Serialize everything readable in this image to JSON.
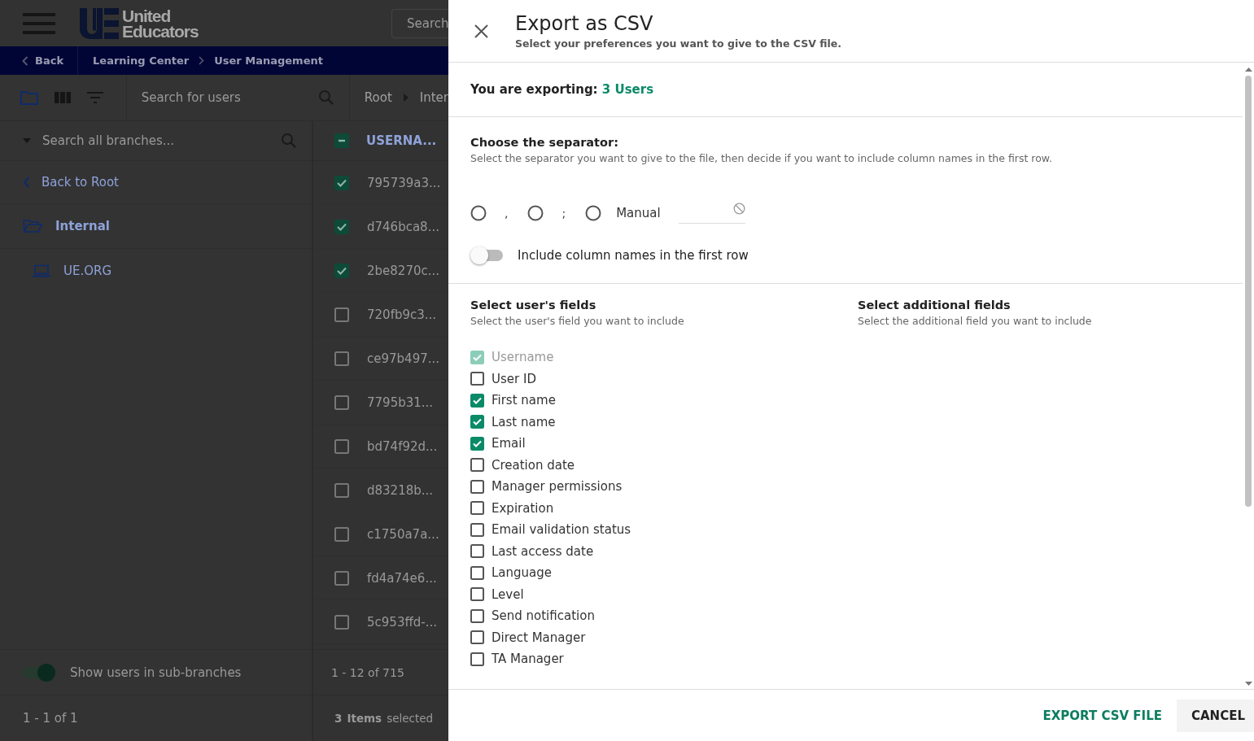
{
  "app": {
    "logo": {
      "line1": "United",
      "line2": "Educators"
    },
    "search_placeholder": "Search",
    "nav": {
      "back": "Back",
      "breadcrumbs": [
        "Learning Center",
        "User Management"
      ]
    },
    "toolbar": {
      "search_placeholder": "Search for users",
      "path": [
        "Root",
        "Inter"
      ]
    },
    "branches": {
      "search_placeholder": "Search all branches...",
      "back": "Back to Root",
      "tree": [
        {
          "label": "Internal",
          "expanded": true,
          "children": [
            {
              "label": "UE.ORG"
            }
          ]
        }
      ],
      "sub_branches": {
        "label": "Show users in sub-branches",
        "on": true
      },
      "pager": "1 - 1 of 1"
    },
    "table": {
      "header": {
        "label": "USERNA...",
        "indeterminate": true
      },
      "rows": [
        {
          "username": "795739a3...",
          "checked": true
        },
        {
          "username": "d746bca8...",
          "checked": true
        },
        {
          "username": "2be8270c...",
          "checked": true
        },
        {
          "username": "720fb9c3...",
          "checked": false
        },
        {
          "username": "ce97b497...",
          "checked": false
        },
        {
          "username": "7795b31...",
          "checked": false
        },
        {
          "username": "bd74f92d...",
          "checked": false
        },
        {
          "username": "d83218b...",
          "checked": false
        },
        {
          "username": "c1750a7a...",
          "checked": false
        },
        {
          "username": "fd4a74e6...",
          "checked": false
        },
        {
          "username": "5c953ffd-...",
          "checked": false
        }
      ],
      "pager": "1 - 12 of 715",
      "selection": {
        "count": "3",
        "label": "Items",
        "suffix": "selected"
      }
    }
  },
  "dialog": {
    "title": "Export as CSV",
    "subtitle": "Select your preferences you want to give to the CSV file.",
    "exporting": {
      "label": "You are exporting:",
      "value": "3 Users"
    },
    "separator": {
      "heading": "Choose the separator:",
      "description": "Select the separator you want to give to the file, then decide if you want to include column names in the first row.",
      "options": [
        {
          "label": ",",
          "selected": false,
          "kind": "fixed"
        },
        {
          "label": ";",
          "selected": false,
          "kind": "fixed"
        },
        {
          "label": "Manual",
          "selected": false,
          "kind": "manual"
        }
      ],
      "include_names": {
        "label": "Include column names in the first row",
        "on": false
      }
    },
    "user_fields": {
      "heading": "Select user's fields",
      "description": "Select the user's field you want to include",
      "fields": [
        {
          "label": "Username",
          "checked": true,
          "disabled": true
        },
        {
          "label": "User ID",
          "checked": false,
          "disabled": false
        },
        {
          "label": "First name",
          "checked": true,
          "disabled": false
        },
        {
          "label": "Last name",
          "checked": true,
          "disabled": false
        },
        {
          "label": "Email",
          "checked": true,
          "disabled": false
        },
        {
          "label": "Creation date",
          "checked": false,
          "disabled": false
        },
        {
          "label": "Manager permissions",
          "checked": false,
          "disabled": false
        },
        {
          "label": "Expiration",
          "checked": false,
          "disabled": false
        },
        {
          "label": "Email validation status",
          "checked": false,
          "disabled": false
        },
        {
          "label": "Last access date",
          "checked": false,
          "disabled": false
        },
        {
          "label": "Language",
          "checked": false,
          "disabled": false
        },
        {
          "label": "Level",
          "checked": false,
          "disabled": false
        },
        {
          "label": "Send notification",
          "checked": false,
          "disabled": false
        },
        {
          "label": "Direct Manager",
          "checked": false,
          "disabled": false
        },
        {
          "label": "TA Manager",
          "checked": false,
          "disabled": false
        }
      ]
    },
    "additional_fields": {
      "heading": "Select additional fields",
      "description": "Select the additional field you want to include"
    },
    "buttons": [
      {
        "label": "EXPORT CSV FILE",
        "kind": "primary"
      },
      {
        "label": "CANCEL",
        "kind": "secondary"
      }
    ]
  }
}
